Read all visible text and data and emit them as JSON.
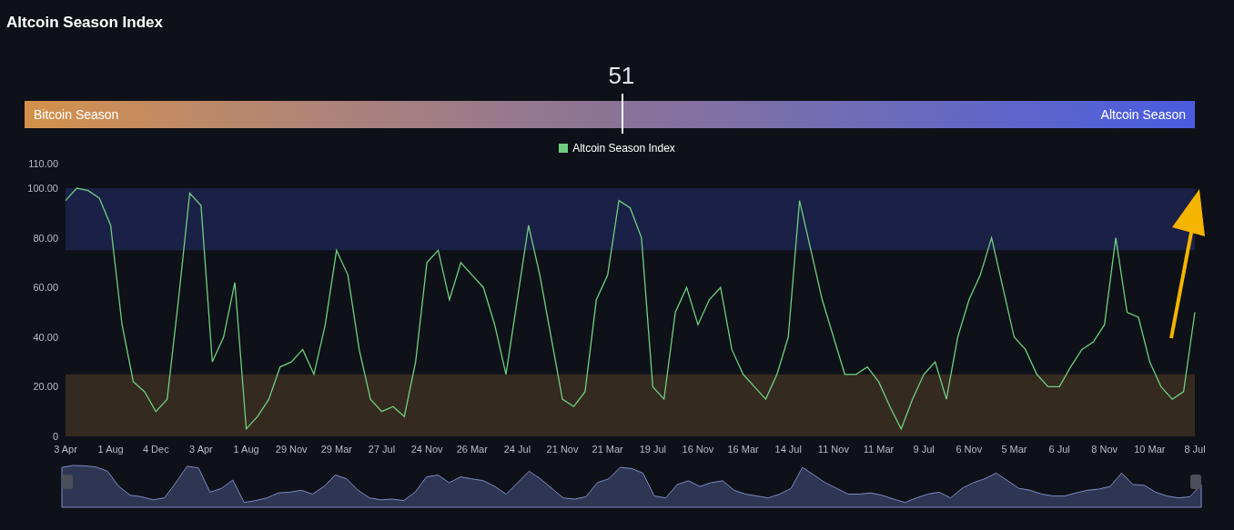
{
  "title": "Altcoin Season Index",
  "gauge": {
    "value": "51",
    "level": 0.51,
    "left_label": "Bitcoin Season",
    "right_label": "Altcoin Season"
  },
  "chart_data": {
    "type": "line",
    "ylim": [
      0,
      110
    ],
    "categories": [
      "3 Apr",
      null,
      null,
      null,
      "1 Aug",
      null,
      null,
      null,
      "4 Dec",
      null,
      null,
      null,
      "3 Apr",
      null,
      null,
      null,
      "1 Aug",
      null,
      null,
      null,
      "29 Nov",
      null,
      null,
      null,
      "29 Mar",
      null,
      null,
      null,
      "27 Jul",
      null,
      null,
      null,
      "24 Nov",
      null,
      null,
      null,
      "26 Mar",
      null,
      null,
      null,
      "24 Jul",
      null,
      null,
      null,
      "21 Nov",
      null,
      null,
      null,
      "21 Mar",
      null,
      null,
      null,
      "19 Jul",
      null,
      null,
      null,
      "16 Nov",
      null,
      null,
      null,
      "16 Mar",
      null,
      null,
      null,
      "14 Jul",
      null,
      null,
      null,
      "11 Nov",
      null,
      null,
      null,
      "11 Mar",
      null,
      null,
      null,
      "9 Jul",
      null,
      null,
      null,
      "6 Nov",
      null,
      null,
      null,
      "5 Mar",
      null,
      null,
      null,
      "6 Jul",
      null,
      null,
      null,
      "8 Nov",
      null,
      null,
      null,
      "10 Mar",
      null,
      null,
      null,
      "8 Jul"
    ],
    "yticks": [
      {
        "value": 0,
        "label": "0"
      },
      {
        "value": 20,
        "label": "20.00"
      },
      {
        "value": 40,
        "label": "40.00"
      },
      {
        "value": 60,
        "label": "60.00"
      },
      {
        "value": 80,
        "label": "80.00"
      },
      {
        "value": 100,
        "label": "100.00"
      },
      {
        "value": 110,
        "label": "110.00"
      }
    ],
    "bands": [
      {
        "axis": "y",
        "from": 75,
        "to": 100,
        "color": "#1b2046"
      },
      {
        "axis": "y",
        "from": 0,
        "to": 25,
        "color": "#352a20"
      }
    ],
    "series": [
      {
        "name": "Altcoin Season Index",
        "color": "#6fcf7f",
        "values": [
          95,
          100,
          99,
          96,
          85,
          45,
          22,
          18,
          10,
          15,
          55,
          98,
          93,
          30,
          40,
          62,
          3,
          8,
          15,
          28,
          30,
          35,
          25,
          45,
          75,
          65,
          35,
          15,
          10,
          12,
          8,
          30,
          70,
          75,
          55,
          70,
          65,
          60,
          45,
          25,
          55,
          85,
          65,
          40,
          15,
          12,
          18,
          55,
          65,
          95,
          92,
          80,
          20,
          15,
          50,
          60,
          45,
          55,
          60,
          35,
          25,
          20,
          15,
          25,
          40,
          95,
          75,
          55,
          40,
          25,
          25,
          28,
          22,
          12,
          3,
          15,
          25,
          30,
          15,
          40,
          55,
          65,
          80,
          60,
          40,
          35,
          25,
          20,
          20,
          28,
          35,
          38,
          45,
          80,
          50,
          48,
          30,
          20,
          15,
          18,
          50
        ]
      }
    ]
  }
}
